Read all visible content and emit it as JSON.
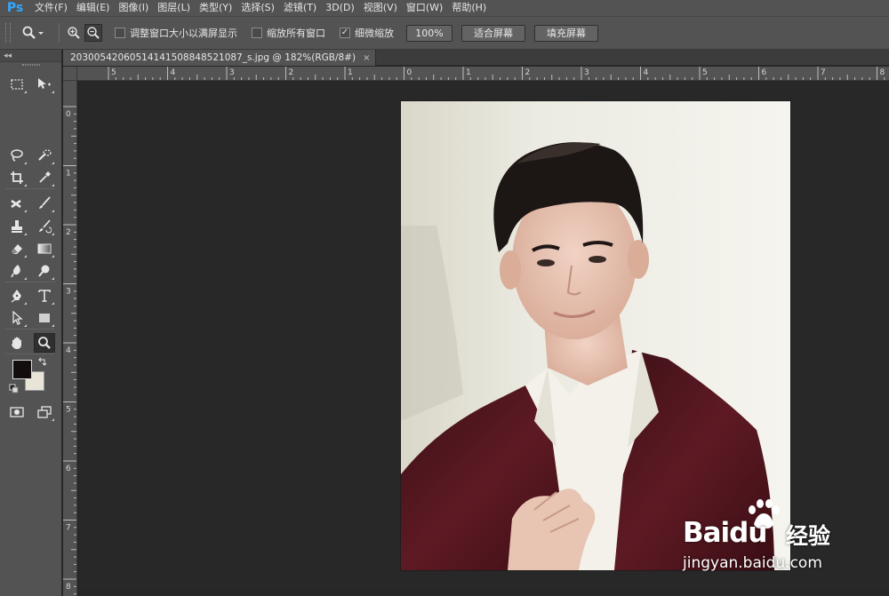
{
  "app": {
    "logo": "Ps"
  },
  "menu": {
    "items": [
      "文件(F)",
      "编辑(E)",
      "图像(I)",
      "图层(L)",
      "类型(Y)",
      "选择(S)",
      "滤镜(T)",
      "3D(D)",
      "视图(V)",
      "窗口(W)",
      "帮助(H)"
    ]
  },
  "options": {
    "resize_windows_label": "调整窗口大小以满屏显示",
    "resize_windows_checked": false,
    "zoom_all_label": "缩放所有窗口",
    "zoom_all_checked": false,
    "scrubby_label": "细微缩放",
    "scrubby_checked": true,
    "btn_100": "100%",
    "btn_fit": "适合屏幕",
    "btn_fill": "填充屏幕"
  },
  "document": {
    "tab_title": "20300542060514141508848521087_s.jpg @ 182%(RGB/8#)",
    "close_glyph": "×"
  },
  "tools": {
    "collapse_glyph": "◂◂",
    "foreground_color": "#140d0e",
    "background_color": "#e8e5d8"
  },
  "rulers": {
    "horizontal": [
      "5",
      "4",
      "3",
      "2",
      "1",
      "0",
      "1",
      "2",
      "3",
      "4",
      "5",
      "6",
      "7",
      "8"
    ],
    "vertical": [
      "0",
      "1",
      "2",
      "3",
      "4",
      "5",
      "6",
      "7",
      "8"
    ]
  },
  "watermark": {
    "logo": "Baidu",
    "cn": "经验",
    "url": "jingyan.baidu.com"
  }
}
